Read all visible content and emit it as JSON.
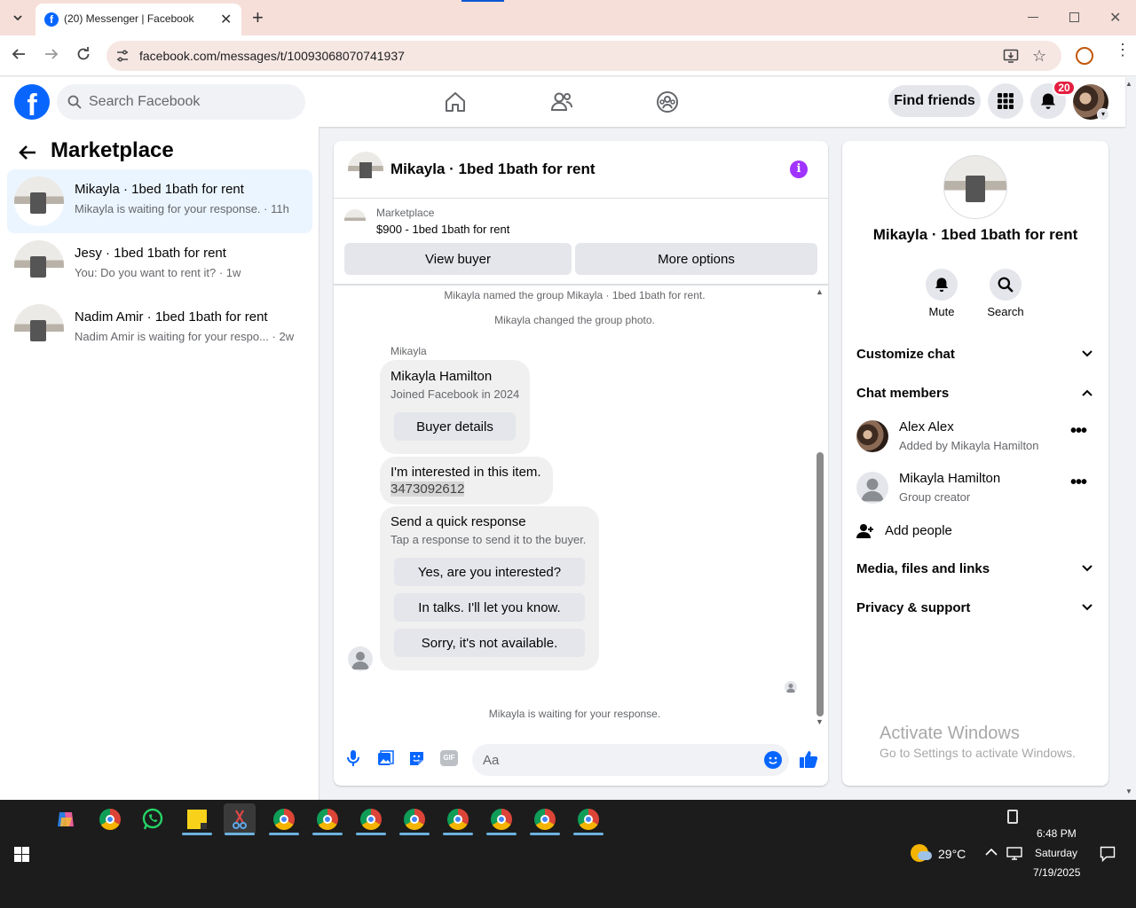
{
  "browser": {
    "tab_title": "(20) Messenger | Facebook",
    "url": "facebook.com/messages/t/10093068070741937"
  },
  "header": {
    "search_placeholder": "Search Facebook",
    "find_friends": "Find friends",
    "notifications_count": "20"
  },
  "left_panel": {
    "title": "Marketplace",
    "conversations": [
      {
        "name": "Mikayla · 1bed 1bath for rent",
        "preview": "Mikayla is waiting for your response. · 11h"
      },
      {
        "name": "Jesy · 1bed 1bath for rent",
        "preview": "You: Do you want to rent it? · 1w"
      },
      {
        "name": "Nadim Amir · 1bed 1bath for rent",
        "preview": "Nadim Amir is waiting for your respo... · 2w"
      }
    ]
  },
  "chat": {
    "title": "Mikayla · 1bed 1bath for rent",
    "listing_source": "Marketplace",
    "listing": "$900 - 1bed 1bath for rent",
    "view_buyer": "View buyer",
    "more_options": "More options",
    "system_1": "Mikayla named the group Mikayla · 1bed 1bath for rent.",
    "system_2": "Mikayla changed the group photo.",
    "sender": "Mikayla",
    "profile_name": "Mikayla Hamilton",
    "profile_joined": "Joined Facebook in 2024",
    "buyer_details": "Buyer details",
    "message_line1": "I'm interested in this item.",
    "message_line2": "3473092612",
    "quick_title": "Send a quick response",
    "quick_sub": "Tap a response to send it to the buyer.",
    "quick_1": "Yes, are you interested?",
    "quick_2": "In talks. I'll let you know.",
    "quick_3": "Sorry, it's not available.",
    "waiting": "Mikayla is waiting for your response.",
    "composer_placeholder": "Aa"
  },
  "info_panel": {
    "title": "Mikayla · 1bed 1bath for rent",
    "mute": "Mute",
    "search": "Search",
    "customize": "Customize chat",
    "members_header": "Chat members",
    "members": [
      {
        "name": "Alex Alex",
        "role": "Added by Mikayla Hamilton"
      },
      {
        "name": "Mikayla Hamilton",
        "role": "Group creator"
      }
    ],
    "add_people": "Add people",
    "media": "Media, files and links",
    "privacy": "Privacy & support"
  },
  "watermark": {
    "title": "Activate Windows",
    "sub": "Go to Settings to activate Windows."
  },
  "taskbar": {
    "weather": "29°C",
    "time": "6:48 PM",
    "day": "Saturday",
    "date": "7/19/2025"
  },
  "colors": {
    "fb_blue": "#0866ff",
    "messenger_purple": "#a033ff",
    "active_conv": "#ebf5ff",
    "badge_red": "#e41e3f"
  }
}
